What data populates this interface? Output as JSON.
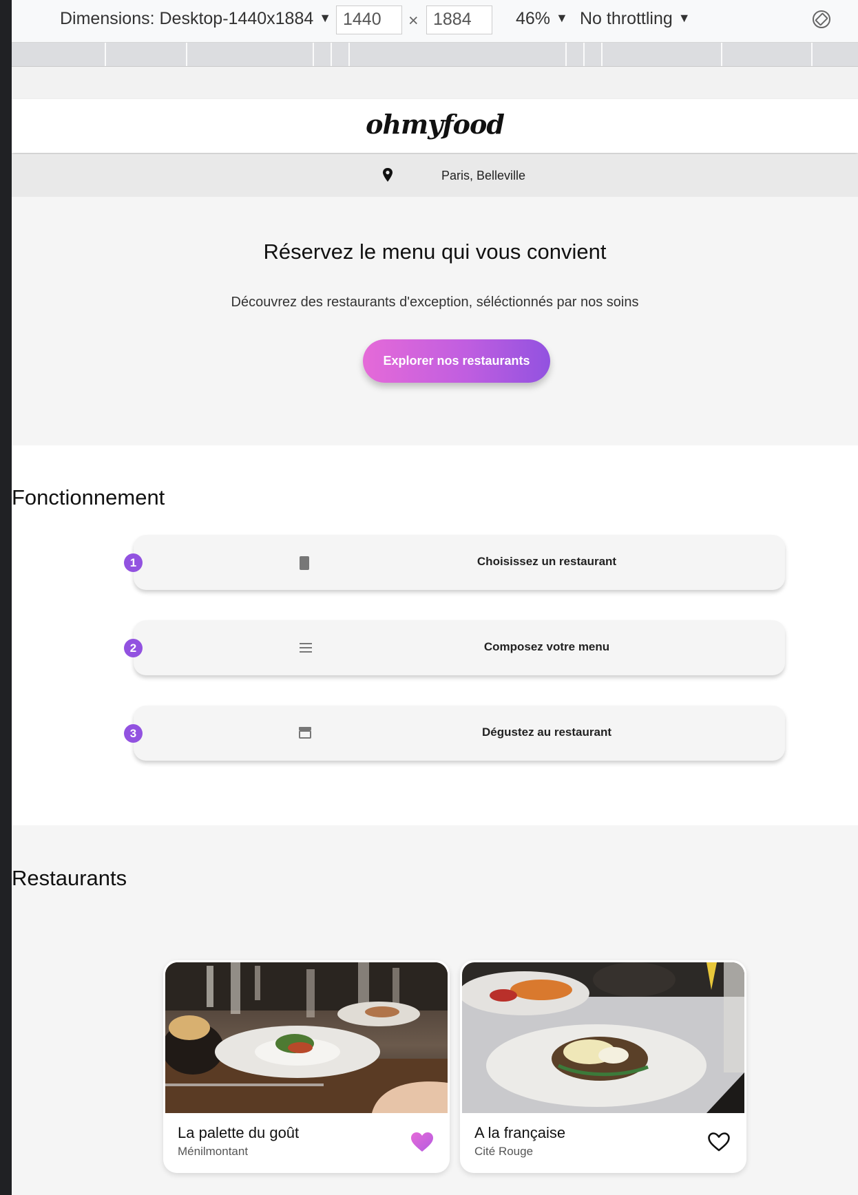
{
  "devtools": {
    "dimensions_label": "Dimensions: Desktop-1440x1884",
    "width": "1440",
    "times": "×",
    "height": "1884",
    "zoom": "46%",
    "throttling": "No throttling",
    "caret": "▼"
  },
  "site": {
    "logo": "ohmyfood",
    "location": "Paris, Belleville"
  },
  "hero": {
    "title": "Réservez le menu qui vous convient",
    "subtitle": "Découvrez des restaurants d'exception, séléctionnés par nos soins",
    "cta_label": "Explorer nos restaurants"
  },
  "how": {
    "title": "Fonctionnement",
    "steps": [
      {
        "number": "1",
        "label": "Choisissez un restaurant",
        "icon": "mobile-phone-icon"
      },
      {
        "number": "2",
        "label": "Composez votre menu",
        "icon": "list-icon"
      },
      {
        "number": "3",
        "label": "Dégustez au restaurant",
        "icon": "store-icon"
      }
    ]
  },
  "restaurants": {
    "title": "Restaurants",
    "cards": [
      {
        "name": "La palette du goût",
        "area": "Ménilmontant",
        "favorite": true
      },
      {
        "name": "A la française",
        "area": "Cité Rouge",
        "favorite": false
      }
    ]
  },
  "colors": {
    "accent_pink": "#e56ad8",
    "accent_purple": "#9252e0"
  }
}
